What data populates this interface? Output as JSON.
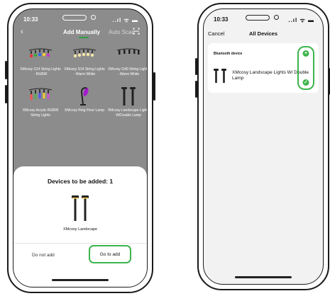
{
  "status_left": {
    "time": "10:33",
    "signal": "..ıl ᯤ ▬"
  },
  "status_right": {
    "time": "10:33",
    "signal": "..ıl ᯤ ▬"
  },
  "add_screen": {
    "back_glyph": "‹",
    "tabs": [
      {
        "label": "Add Manually",
        "active": true
      },
      {
        "label": "Auto Scan",
        "active": false
      }
    ],
    "scan_icon": "scan-icon",
    "products": [
      {
        "label": "XMcosy S14 String Lights - RGBW",
        "icon": "string-lights-icon"
      },
      {
        "label": "XMcosy S14 String Lights - Warm White",
        "icon": "string-lights-icon"
      },
      {
        "label": "XMcosy G40 String Lights - Warm White",
        "icon": "string-lights-icon"
      },
      {
        "label": "XMcosy Acrylic RGBW String Lights",
        "icon": "string-lights-icon"
      },
      {
        "label": "XMcosy Ring Floor Lamp",
        "icon": "floor-lamp-icon"
      },
      {
        "label": "XMcosy Landscape Lights W/Double Lamp",
        "icon": "landscape-lamp-icon"
      }
    ],
    "sheet": {
      "title": "Devices to be added: 1",
      "device_name": "XMcosy Landscape",
      "cancel_label": "Do not add",
      "confirm_label": "Go to add"
    }
  },
  "devices_screen": {
    "cancel_label": "Cancel",
    "title": "All Devices",
    "section_label": "Bluetooth device",
    "device_name": "XMcosy Landscape Lights W/ Double Lamp",
    "add_glyph": "+",
    "check_glyph": "✓"
  },
  "colors": {
    "accent_green": "#3cb44b",
    "overlay_gray": "#8c8c8c"
  }
}
